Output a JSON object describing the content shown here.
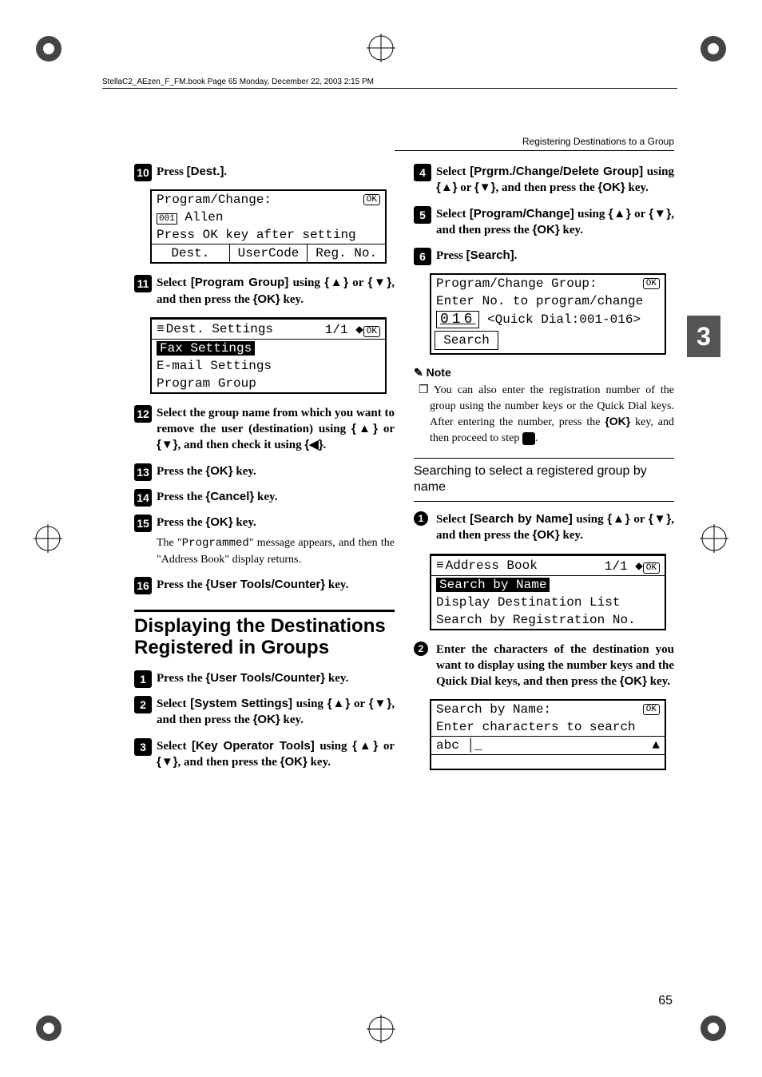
{
  "header_line": "StellaC2_AEzen_F_FM.book  Page 65  Monday, December 22, 2003  2:15 PM",
  "running_header": "Registering Destinations to a Group",
  "side_tab": "3",
  "page_number": "65",
  "left_col": {
    "step10": {
      "num": "10",
      "text_pre": "Press ",
      "ui": "[Dest.]",
      "text_post": "."
    },
    "lcd1": {
      "line1": "Program/Change:",
      "ok": "OK",
      "id": "001",
      "name": "Allen",
      "line3": "Press OK key after setting",
      "btn1": "Dest.",
      "btn2": "UserCode",
      "btn3": "Reg. No."
    },
    "step11": {
      "num": "11",
      "text": "Select [Program Group] using {U} or {T}, and then press the {OK} key.",
      "parts": [
        "Select ",
        "[Program Group]",
        " using ",
        "{▲}",
        " or ",
        "{▼}",
        ", and then press the ",
        "{OK}",
        " key."
      ]
    },
    "lcd2": {
      "header": "Dest. Settings",
      "page": "1/1",
      "ok": "OK",
      "item1": "Fax Settings",
      "item2": "E-mail Settings",
      "item3": "Program Group"
    },
    "step12": {
      "num": "12",
      "parts": [
        "Select the group name from which you want to remove the user (destination) using ",
        "{▲}",
        " or ",
        "{▼}",
        ", and then check it using ",
        "{◀}",
        "."
      ]
    },
    "step13": {
      "num": "13",
      "parts": [
        "Press the ",
        "{OK}",
        " key."
      ]
    },
    "step14": {
      "num": "14",
      "parts": [
        "Press the ",
        "{Cancel}",
        " key."
      ]
    },
    "step15": {
      "num": "15",
      "parts": [
        "Press the ",
        "{OK}",
        " key."
      ],
      "body": [
        "The \"",
        "Programmed",
        "\" message appears, and then the \"Address Book\" display returns."
      ]
    },
    "step16": {
      "num": "16",
      "parts": [
        "Press the ",
        "{User Tools/Counter}",
        " key."
      ]
    },
    "section_heading": "Displaying the Destinations Registered in Groups",
    "stepA": {
      "num": "1",
      "parts": [
        "Press the ",
        "{User Tools/Counter}",
        " key."
      ]
    },
    "stepB": {
      "num": "2",
      "parts": [
        "Select ",
        "[System Settings]",
        " using ",
        "{▲}",
        " or ",
        "{▼}",
        ", and then press the ",
        "{OK}",
        " key."
      ]
    },
    "stepC": {
      "num": "3",
      "parts": [
        "Select ",
        "[Key Operator Tools]",
        " using ",
        "{▲}",
        " or ",
        "{▼}",
        ", and then press the ",
        "{OK}",
        " key."
      ]
    }
  },
  "right_col": {
    "stepD": {
      "num": "4",
      "parts": [
        "Select ",
        "[Prgrm./Change/Delete Group]",
        " using ",
        "{▲}",
        " or ",
        "{▼}",
        ", and then press the ",
        "{OK}",
        " key."
      ]
    },
    "stepE": {
      "num": "5",
      "parts": [
        "Select ",
        "[Program/Change]",
        " using ",
        "{▲}",
        " or ",
        "{▼}",
        ", and then press the ",
        "{OK}",
        " key."
      ]
    },
    "stepF": {
      "num": "6",
      "parts": [
        "Press ",
        "[Search]",
        "."
      ]
    },
    "lcd3": {
      "line1": "Program/Change Group:",
      "ok": "OK",
      "line2": "Enter No. to program/change",
      "bignum": "016",
      "hint": "<Quick Dial:001-016>",
      "btn": "Search"
    },
    "note_label": "Note",
    "note_text": "You can also enter the registration number of the group using the number keys or the Quick Dial keys. After entering the number, press the {OK} key, and then proceed to step 7.",
    "note_parts": [
      "You can also enter the registration number of the group using the number keys or the Quick Dial keys. After entering the number, press the ",
      "{OK}",
      " key, and then proceed to step ",
      "7",
      "."
    ],
    "sub_heading": "Searching to select a registered group by name",
    "sub1": {
      "num": "1",
      "parts": [
        "Select ",
        "[Search by Name]",
        " using ",
        "{▲}",
        " or ",
        "{▼}",
        ", and then press the ",
        "{OK}",
        " key."
      ]
    },
    "lcd4": {
      "header": "Address Book",
      "page": "1/1",
      "ok": "OK",
      "item1": "Search by Name",
      "item2": "Display Destination List",
      "item3": "Search by Registration No."
    },
    "sub2": {
      "num": "2",
      "parts": [
        "Enter the characters of the destination you want to display using the number keys and the Quick Dial keys, and then press the ",
        "{OK}",
        " key."
      ]
    },
    "lcd5": {
      "line1": "Search by Name:",
      "ok": "OK",
      "line2": "Enter characters to search",
      "mode": "abc",
      "cursor": "_",
      "arrow": "▲"
    }
  }
}
